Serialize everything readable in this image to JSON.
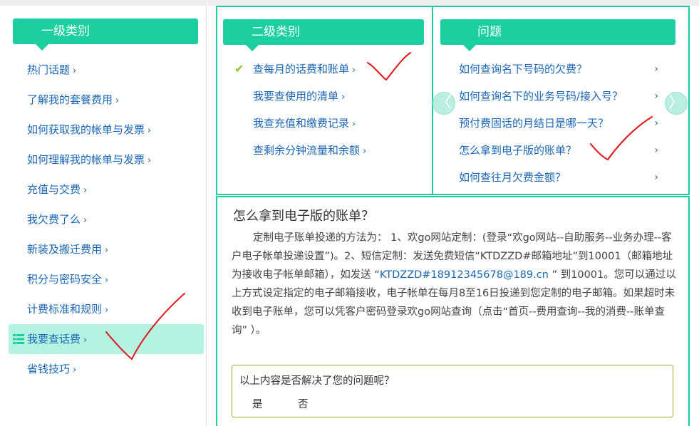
{
  "sidebar": {
    "heading": "一级类别",
    "items": [
      {
        "label": "热门话题"
      },
      {
        "label": "了解我的套餐费用"
      },
      {
        "label": "如何获取我的帐单与发票"
      },
      {
        "label": "如何理解我的帐单与发票"
      },
      {
        "label": "充值与交费"
      },
      {
        "label": "我欠费了么"
      },
      {
        "label": "新装及搬迁费用"
      },
      {
        "label": "积分与密码安全"
      },
      {
        "label": "计费标准和规则"
      },
      {
        "label": "我要查话费"
      },
      {
        "label": "省钱技巧"
      }
    ],
    "active_index": 9,
    "chevron": "›"
  },
  "secondary": {
    "heading": "二级类别",
    "items": [
      {
        "label": "查每月的话费和账单"
      },
      {
        "label": "我要查使用的清单"
      },
      {
        "label": "我查充值和缴费记录"
      },
      {
        "label": "查剩余分钟流量和余额"
      }
    ],
    "checked_index": 0,
    "check_glyph": "✔"
  },
  "questions": {
    "heading": "问题",
    "items": [
      {
        "label": "如何查询名下号码的欠费？"
      },
      {
        "label": "如何查询名下的业务号码/接入号？"
      },
      {
        "label": "预付费固话的月结日是哪一天？"
      },
      {
        "label": "怎么拿到电子版的账单？"
      },
      {
        "label": "如何查往月欠费金额？"
      }
    ],
    "chevron": "›",
    "prev_glyph": "〈",
    "next_glyph": "〉"
  },
  "answer": {
    "title": "怎么拿到电子版的账单？",
    "body_part1": "定制电子账单投递的方法为： 1、欢go网站定制：(登录“欢go网站--自助服务--业务办理--客户电子帐单投递设置”)。2、短信定制：发送免费短信“KTDZZD#邮箱地址”到10001（邮箱地址为接收电子帐单邮箱），如发送 “",
    "body_link": "KTDZZD#18912345678@189.cn",
    "body_part2": " ” 到10001。您可以通过以上方式设定指定的电子邮箱接收，电子帐单在每月8至16日投递到您定制的电子邮箱。如果超时未收到电子账单，您可以凭客户密码登录欢go网站查询（点击“首页--费用查询--我的消费--账单查询” ）。"
  },
  "feedback": {
    "question": "以上内容是否解决了您的问题呢？",
    "yes": "是",
    "no": "否"
  },
  "colors": {
    "accent": "#1ccfa0",
    "link": "#1b66b7",
    "active_bg": "#b4f3e2",
    "check": "#8ccb2c",
    "annotation": "#e0161b"
  }
}
